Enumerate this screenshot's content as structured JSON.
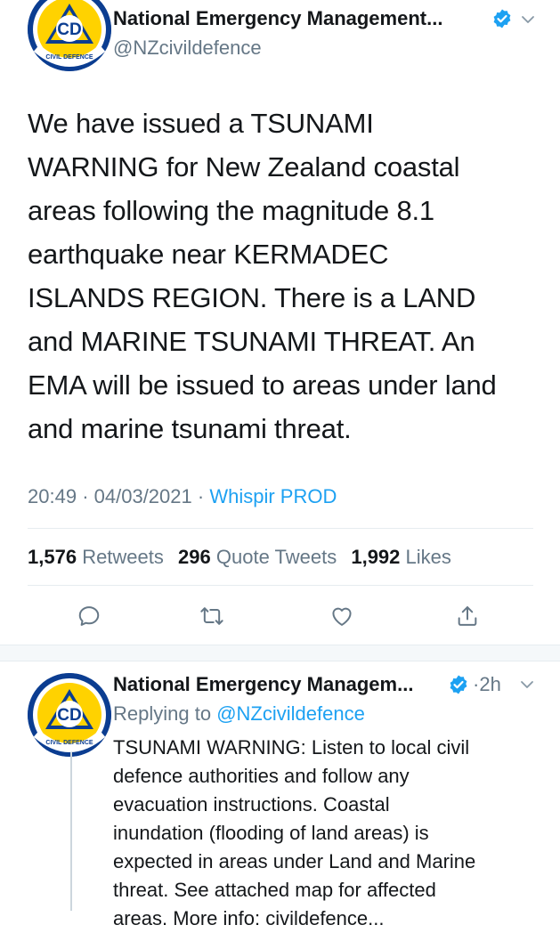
{
  "main_tweet": {
    "author_name": "National Emergency Management...",
    "handle": "@NZcivildefence",
    "avatar": {
      "letters": "CD",
      "ring_text": "CIVIL DEFENCE"
    },
    "body": "We have issued a TSUNAMI\nWARNING for New Zealand coastal\nareas following the magnitude 8.1\nearthquake near KERMADEC\nISLANDS REGION. There is a LAND\nand MARINE TSUNAMI THREAT. An\nEMA will be issued to areas under land\nand marine tsunami threat.",
    "time": "20:49",
    "date": "04/03/2021",
    "separator": "·",
    "source": "Whispir PROD",
    "stats": {
      "retweets_count": "1,576",
      "retweets_label": "Retweets",
      "quotes_count": "296",
      "quotes_label": "Quote Tweets",
      "likes_count": "1,992",
      "likes_label": "Likes"
    },
    "actions": [
      "reply-icon",
      "retweet-icon",
      "like-icon",
      "share-icon"
    ]
  },
  "reply_tweet": {
    "author_name": "National Emergency Managem...",
    "time_ago": "2h",
    "separator": "·",
    "avatar": {
      "letters": "CD",
      "ring_text": "CIVIL DEFENCE"
    },
    "replying_label": "Replying to",
    "replying_mention": "@NZcivildefence",
    "body": "TSUNAMI WARNING: Listen to local civil\ndefence authorities and follow any\nevacuation instructions. Coastal\ninundation (flooding of land areas) is\nexpected in areas under Land and Marine\nthreat. See attached map for affected\nareas. More info: civildefence..."
  },
  "colors": {
    "text": "#14171a",
    "muted": "#657786",
    "link": "#1da1f2",
    "divider": "#e6ecf0",
    "brand_navy": "#0b3d91",
    "brand_yellow": "#ffd200"
  }
}
